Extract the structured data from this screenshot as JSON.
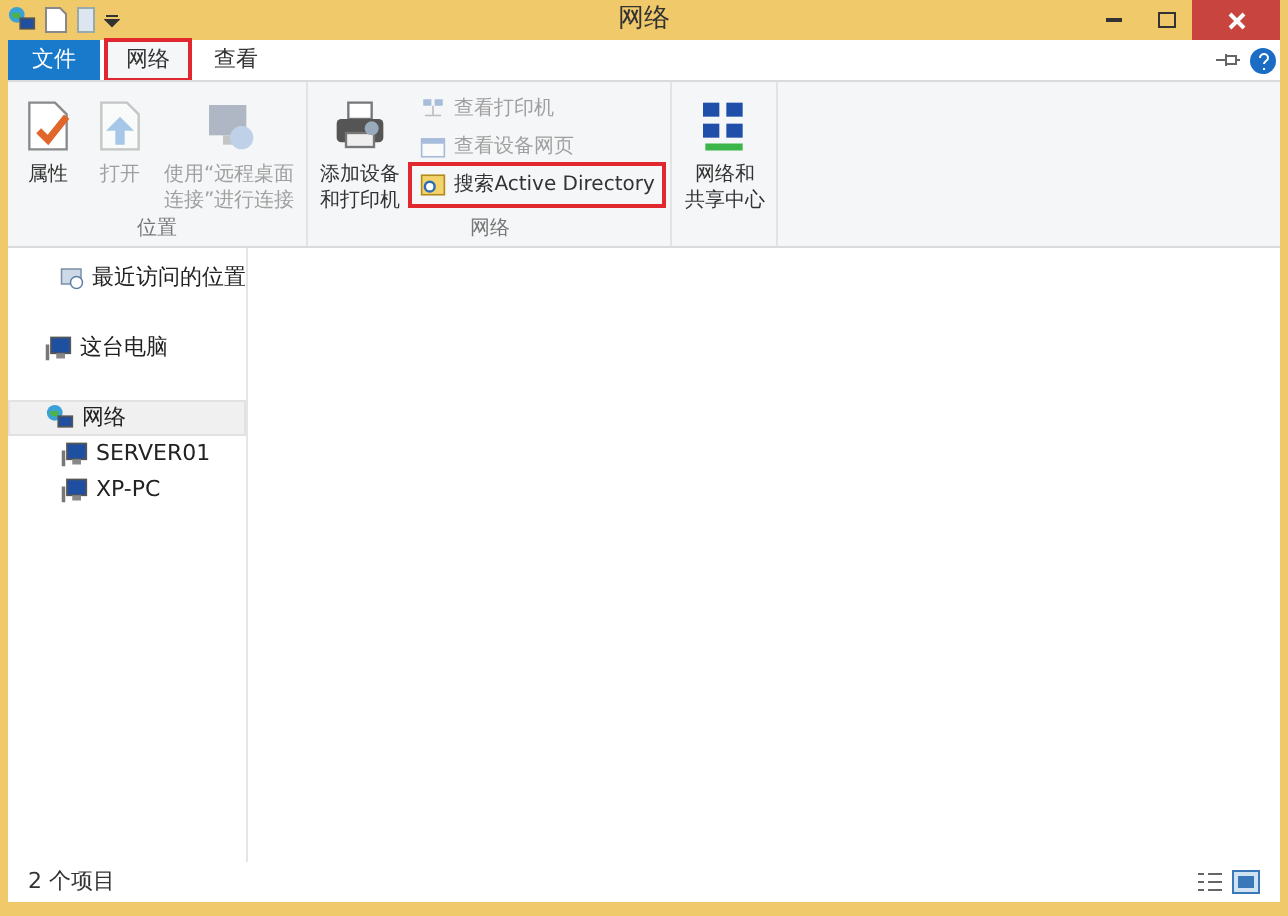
{
  "window": {
    "title": "网络"
  },
  "tabs": [
    {
      "label": "文件",
      "kind": "file",
      "selected": false,
      "highlighted": false
    },
    {
      "label": "网络",
      "kind": "tab",
      "selected": true,
      "highlighted": true
    },
    {
      "label": "查看",
      "kind": "tab",
      "selected": false,
      "highlighted": false
    }
  ],
  "ribbon": {
    "groups": [
      {
        "label": "位置",
        "items": [
          {
            "kind": "large",
            "lines": [
              "属性"
            ],
            "disabled": false,
            "highlighted": false
          },
          {
            "kind": "large",
            "lines": [
              "打开"
            ],
            "disabled": true,
            "highlighted": false
          },
          {
            "kind": "large",
            "lines": [
              "使用“远程桌面",
              "连接”进行连接"
            ],
            "disabled": true,
            "highlighted": false
          }
        ]
      },
      {
        "label": "网络",
        "items": [
          {
            "kind": "large",
            "lines": [
              "添加设备",
              "和打印机"
            ],
            "disabled": false,
            "highlighted": false
          },
          {
            "kind": "small",
            "lines": [
              "查看打印机"
            ],
            "disabled": true,
            "highlighted": false
          },
          {
            "kind": "small",
            "lines": [
              "查看设备网页"
            ],
            "disabled": true,
            "highlighted": false
          },
          {
            "kind": "small",
            "lines": [
              "搜索Active Directory"
            ],
            "disabled": false,
            "highlighted": true
          }
        ]
      },
      {
        "items": [
          {
            "kind": "large",
            "lines": [
              "网络和",
              "共享中心"
            ],
            "disabled": false,
            "highlighted": false
          }
        ]
      }
    ]
  },
  "sidebar": {
    "items": [
      {
        "label": "最近访问的位置",
        "kind": "recent",
        "selected": false
      },
      {
        "label": "这台电脑",
        "kind": "computer",
        "selected": false
      },
      {
        "label": "网络",
        "kind": "network",
        "selected": true,
        "children": [
          {
            "label": "SERVER01",
            "kind": "computer",
            "selected": false
          },
          {
            "label": "XP-PC",
            "kind": "computer",
            "selected": false
          }
        ]
      }
    ]
  },
  "status_bar": {
    "text": "2 个项目"
  }
}
